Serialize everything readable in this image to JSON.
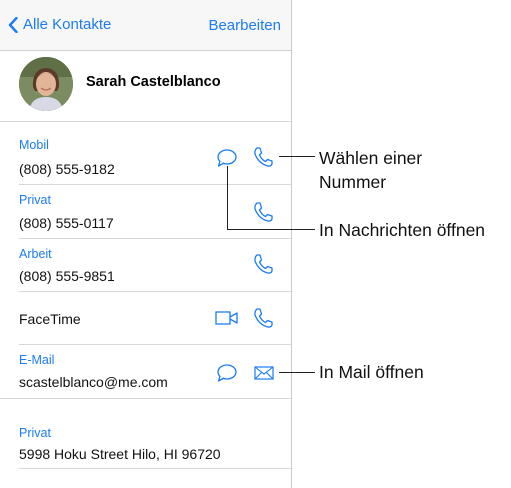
{
  "nav": {
    "back_label": "Alle Kontakte",
    "edit_label": "Bearbeiten"
  },
  "contact": {
    "name": "Sarah Castelblanco"
  },
  "rows": [
    {
      "label": "Mobil",
      "value": "(808) 555-9182",
      "icons": [
        "message-icon",
        "phone-icon"
      ]
    },
    {
      "label": "Privat",
      "value": "(808) 555-0117",
      "icons": [
        "phone-icon"
      ]
    },
    {
      "label": "Arbeit",
      "value": "(808) 555-9851",
      "icons": [
        "phone-icon"
      ]
    },
    {
      "label": "",
      "value": "FaceTime",
      "icons": [
        "video-icon",
        "phone-icon"
      ]
    },
    {
      "label": "E-Mail",
      "value": "scastelblanco@me.com",
      "icons": [
        "message-icon",
        "mail-icon"
      ]
    },
    {
      "label": "Privat",
      "value": "5998 Hoku Street Hilo, HI 96720",
      "icons": []
    }
  ],
  "callouts": {
    "call": "Wählen einer Nummer",
    "call_line1": "Wählen einer",
    "call_line2": "Nummer",
    "messages": "In Nachrichten öffnen",
    "mail": "In Mail öffnen"
  },
  "colors": {
    "accent": "#1b7cf4",
    "separator": "#d8d8dc",
    "navbar": "#f7f7f8"
  }
}
